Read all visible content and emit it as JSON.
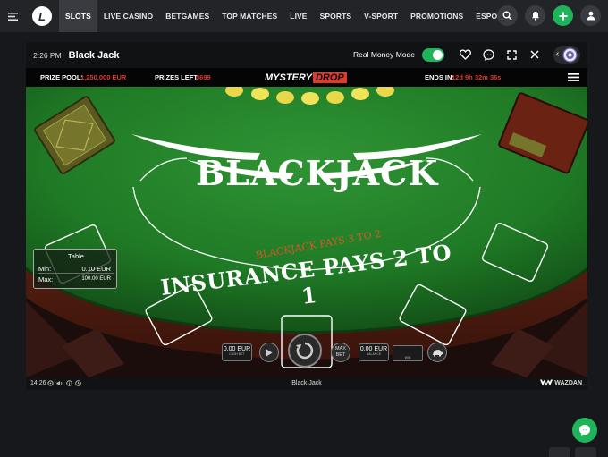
{
  "nav": {
    "items": [
      {
        "label": "SLOTS",
        "active": true
      },
      {
        "label": "LIVE CASINO"
      },
      {
        "label": "BETGAMES"
      },
      {
        "label": "TOP MATCHES"
      },
      {
        "label": "LIVE"
      },
      {
        "label": "SPORTS"
      },
      {
        "label": "V-SPORT"
      },
      {
        "label": "PROMOTIONS"
      },
      {
        "label": "ESPORTS"
      }
    ],
    "more": "•••",
    "logo": "L"
  },
  "game_window": {
    "time": "2:26 PM",
    "title": "Black Jack",
    "real_money_label": "Real Money Mode",
    "real_money_on": true
  },
  "promo_bar": {
    "prize_pool_label": "PRIZE POOL:",
    "prize_pool_value": "1,250,000 EUR",
    "prizes_left_label": "PRIZES LEFT:",
    "prizes_left_value": "3699",
    "brand_left": "MYSTERY",
    "brand_right": "DROP",
    "ends_label": "ENDS IN:",
    "ends_value": "12d 9h 32m 36s"
  },
  "table": {
    "title": "BLACKJACK",
    "pays_line": "BLACKJACK PAYS 3 TO 2",
    "insurance_line": "INSURANCE PAYS 2 TO 1",
    "limits_title": "Table",
    "min_label": "Min:",
    "min_value": "0.10 EUR",
    "max_label": "Max:",
    "max_value": "100.00 EUR"
  },
  "controls": {
    "cash_bet_value": "0.00 EUR",
    "cash_bet_label": "CASH BET",
    "max_bet_top": "MAX",
    "max_bet_bottom": "BET",
    "balance_value": "0.00 EUR",
    "balance_label": "BALANCE",
    "win_label": "WIN"
  },
  "footer": {
    "clock": "14:26",
    "game_name": "Black Jack",
    "provider": "WAZDAN"
  },
  "colors": {
    "accent_green": "#1fb35a",
    "felt_green": "#1f7a25",
    "promo_red": "#e03a2e"
  }
}
